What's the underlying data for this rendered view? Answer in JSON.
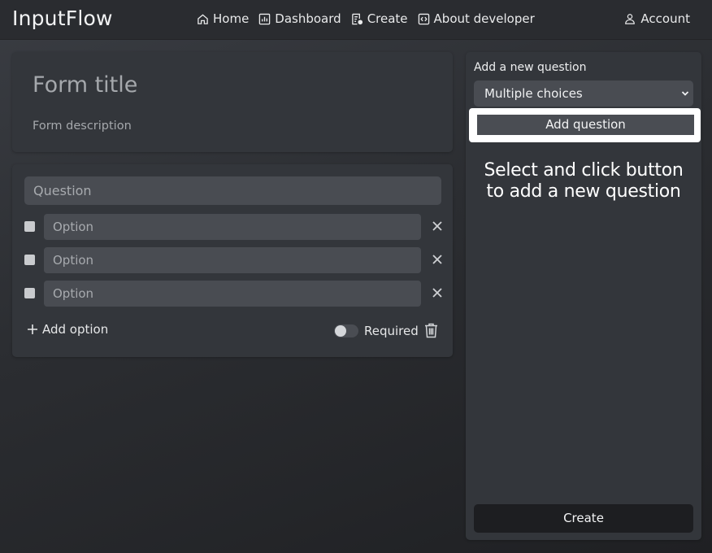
{
  "app": {
    "brand": "InputFlow"
  },
  "nav": {
    "links": [
      {
        "label": "Home",
        "icon": "home-icon"
      },
      {
        "label": "Dashboard",
        "icon": "chart-icon"
      },
      {
        "label": "Create",
        "icon": "form-add-icon"
      },
      {
        "label": "About developer",
        "icon": "code-icon"
      }
    ],
    "account_label": "Account"
  },
  "form": {
    "title_placeholder": "Form title",
    "description_placeholder": "Form description"
  },
  "question": {
    "placeholder": "Question",
    "options": [
      {
        "placeholder": "Option"
      },
      {
        "placeholder": "Option"
      },
      {
        "placeholder": "Option"
      }
    ],
    "add_option_label": "Add option",
    "required_label": "Required",
    "required_on": false
  },
  "sidebar": {
    "label": "Add a new question",
    "selected_type": "Multiple choices",
    "add_button_label": "Add question",
    "hint_line1": "Select and click button",
    "hint_line2": "to add a new question",
    "create_label": "Create"
  },
  "colors": {
    "background": "#2b2d31",
    "card": "#33363b",
    "input": "#494c52",
    "create_button": "#1d1e21"
  }
}
